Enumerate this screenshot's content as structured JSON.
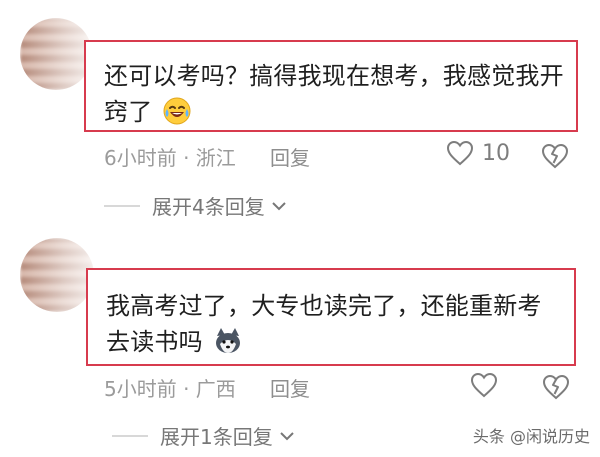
{
  "comments": [
    {
      "text": "还可以考吗？搞得我现在想考，我感觉我开窍了",
      "emoji": "laugh-cry",
      "meta": "6小时前 · 浙江",
      "reply_label": "回复",
      "likes": "10",
      "expand_label": "展开4条回复"
    },
    {
      "text": "我高考过了，大专也读完了，还能重新考去读书吗",
      "emoji": "husky",
      "meta": "5小时前 · 广西",
      "reply_label": "回复",
      "likes": "",
      "expand_label": "展开1条回复"
    }
  ],
  "watermark": "头条 @闲说历史",
  "colors": {
    "highlight_border": "#d73b4e",
    "meta_text": "#9b9b9b"
  }
}
